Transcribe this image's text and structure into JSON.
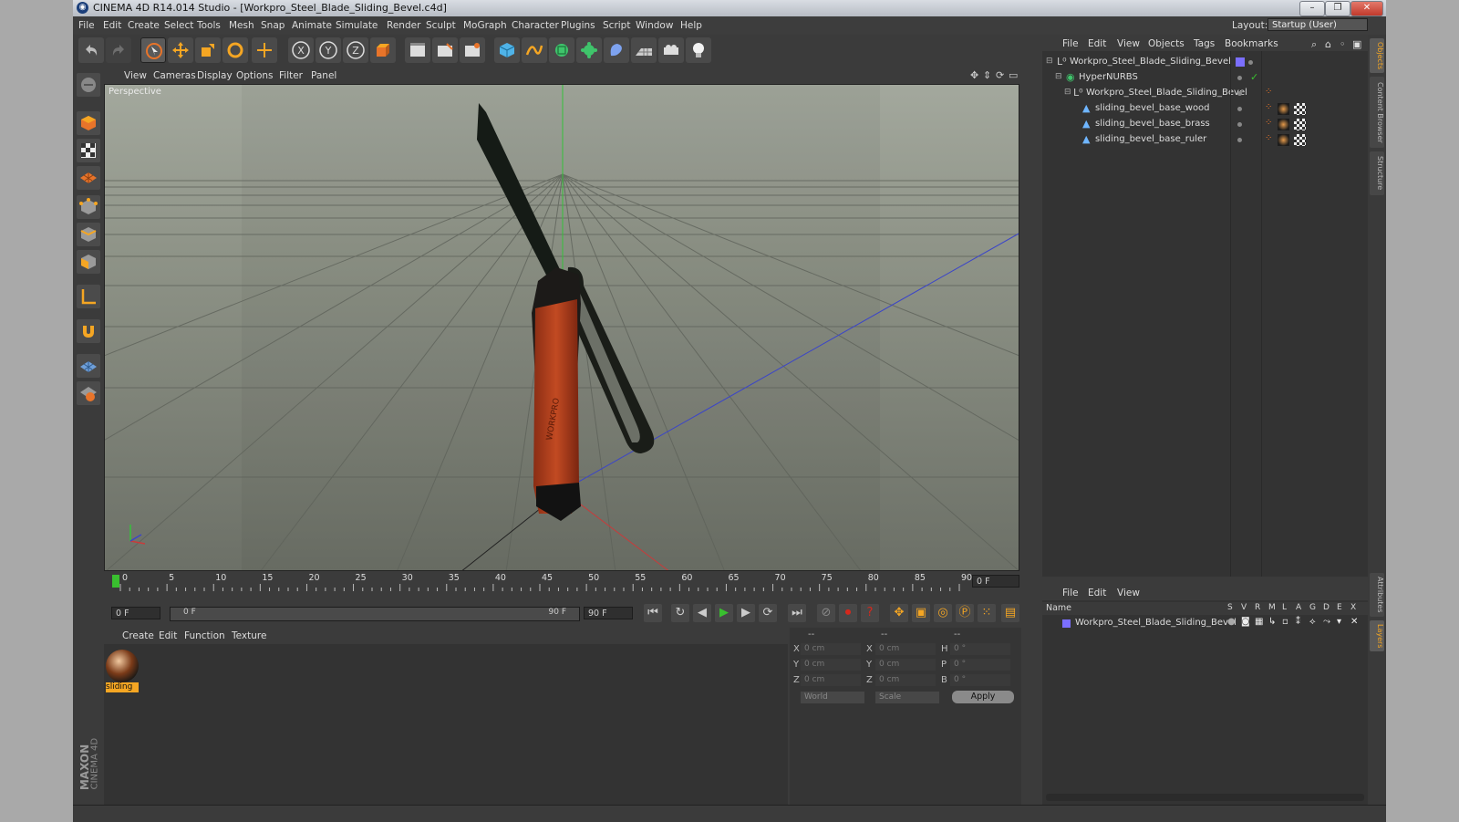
{
  "window": {
    "title": "CINEMA 4D R14.014 Studio - [Workpro_Steel_Blade_Sliding_Bevel.c4d]",
    "buttons": [
      "–",
      "❐",
      "✕"
    ]
  },
  "menubar": {
    "items": [
      "File",
      "Edit",
      "Create",
      "Select",
      "Tools",
      "Mesh",
      "Snap",
      "Animate",
      "Simulate",
      "Render",
      "Sculpt",
      "MoGraph",
      "Character",
      "Plugins",
      "Script",
      "Window",
      "Help"
    ],
    "layout_label": "Layout:",
    "layout_value": "Startup (User)"
  },
  "viewport": {
    "menu": [
      "View",
      "Cameras",
      "Display",
      "Options",
      "Filter",
      "Panel"
    ],
    "label": "Perspective"
  },
  "timeline": {
    "ticks": [
      "0",
      "5",
      "10",
      "15",
      "20",
      "25",
      "30",
      "35",
      "40",
      "45",
      "50",
      "55",
      "60",
      "65",
      "70",
      "75",
      "80",
      "85",
      "90"
    ],
    "current_frame": "0 F"
  },
  "transport": {
    "start_field": "0 F",
    "slider_start": "0 F",
    "slider_end": "90 F",
    "end_field": "90 F"
  },
  "materials": {
    "menu": [
      "Create",
      "Edit",
      "Function",
      "Texture"
    ],
    "items": [
      {
        "label": "sliding"
      }
    ]
  },
  "coords": {
    "headers": [
      "--",
      "--",
      "--"
    ],
    "rows": [
      {
        "l1": "X",
        "v1": "0 cm",
        "l2": "X",
        "v2": "0 cm",
        "l3": "H",
        "v3": "0 °"
      },
      {
        "l1": "Y",
        "v1": "0 cm",
        "l2": "Y",
        "v2": "0 cm",
        "l3": "P",
        "v3": "0 °"
      },
      {
        "l1": "Z",
        "v1": "0 cm",
        "l2": "Z",
        "v2": "0 cm",
        "l3": "B",
        "v3": "0 °"
      }
    ],
    "mode1": "World",
    "mode2": "Scale",
    "apply": "Apply"
  },
  "objects_panel": {
    "menu": [
      "File",
      "Edit",
      "View",
      "Objects",
      "Tags",
      "Bookmarks"
    ],
    "tree": [
      {
        "name": "Workpro_Steel_Blade_Sliding_Bevel"
      },
      {
        "name": "HyperNURBS"
      },
      {
        "name": "Workpro_Steel_Blade_Sliding_Bevel"
      },
      {
        "name": "sliding_bevel_base_wood"
      },
      {
        "name": "sliding_bevel_base_brass"
      },
      {
        "name": "sliding_bevel_base_ruler"
      }
    ]
  },
  "layers_panel": {
    "menu": [
      "File",
      "Edit",
      "View"
    ],
    "name_header": "Name",
    "cols": [
      "S",
      "V",
      "R",
      "M",
      "L",
      "A",
      "G",
      "D",
      "E",
      "X"
    ],
    "row_name": "Workpro_Steel_Blade_Sliding_Bevel"
  },
  "side_tabs": [
    "Objects",
    "Content Browser",
    "Structure",
    "Attributes",
    "Layers"
  ],
  "brand": {
    "line1": "MAXON",
    "line2": "CINEMA 4D"
  },
  "colors": {
    "accent": "#f5a623",
    "play": "#39c02f",
    "record": "#d6281c",
    "layer": "#7b6fff"
  }
}
